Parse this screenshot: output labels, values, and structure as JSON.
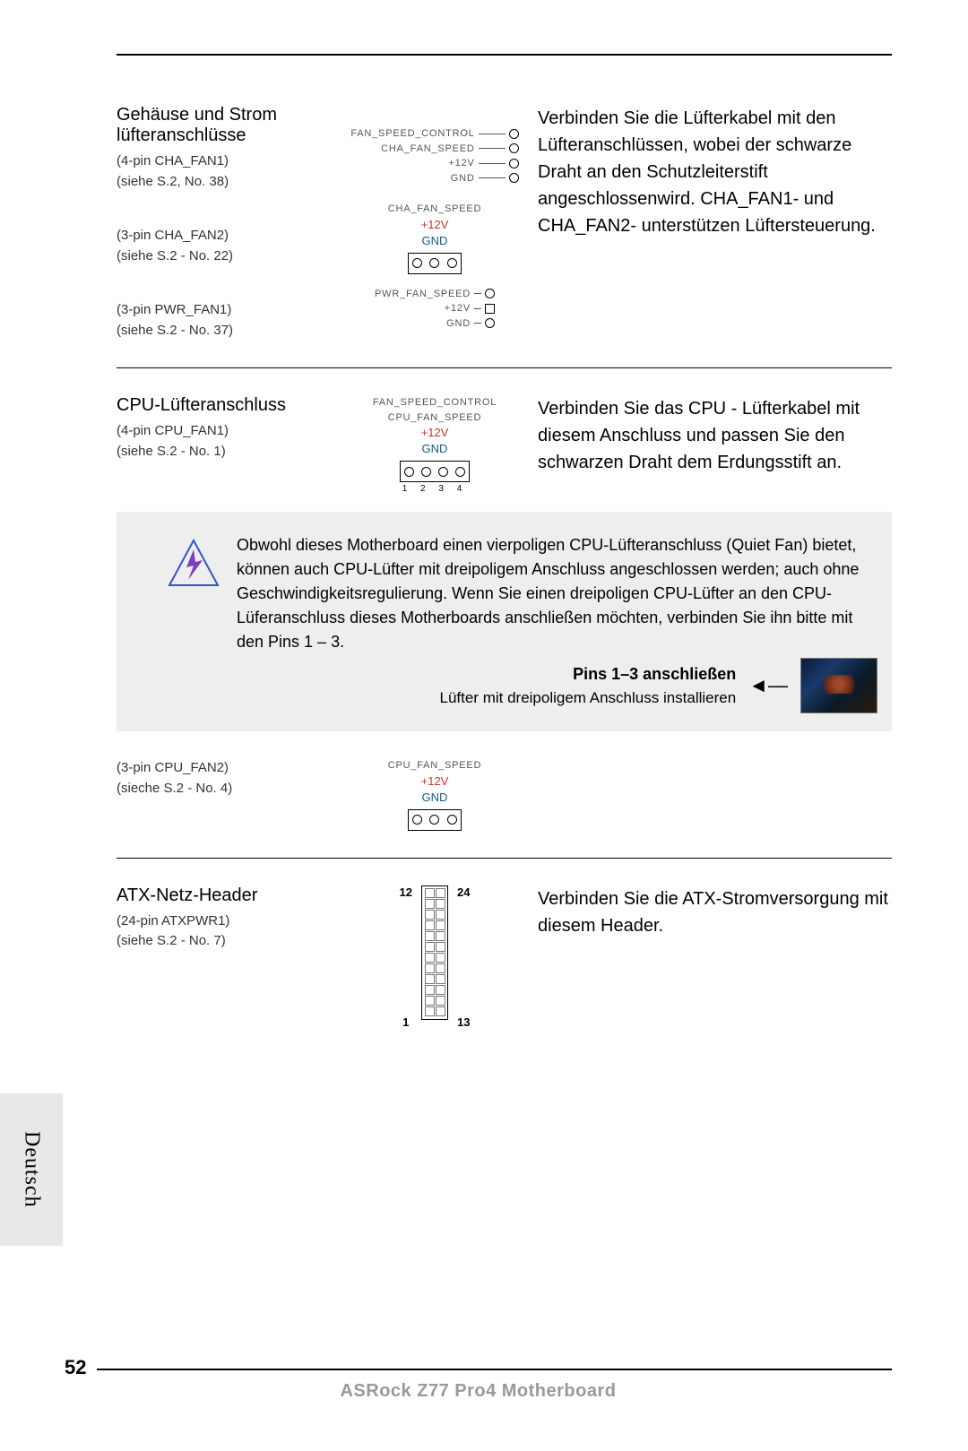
{
  "section1": {
    "title": "Gehäuse und Strom lüfteranschlüsse",
    "items": [
      {
        "label": "(4-pin CHA_FAN1)",
        "ref": "(siehe S.2, No. 38)"
      },
      {
        "label": "(3-pin CHA_FAN2)",
        "ref": "(siehe S.2 - No. 22)"
      },
      {
        "label": "(3-pin PWR_FAN1)",
        "ref": "(siehe S.2 - No. 37)"
      }
    ],
    "diag1": {
      "l1": "FAN_SPEED_CONTROL",
      "l2": "CHA_FAN_SPEED",
      "l3": "+12V",
      "l4": "GND"
    },
    "diag2": {
      "l1": "CHA_FAN_SPEED",
      "l2": "+12V",
      "l3": "GND"
    },
    "diag3": {
      "l1": "PWR_FAN_SPEED",
      "l2": "+12V",
      "l3": "GND"
    },
    "desc": "Verbinden Sie die Lüfterkabel mit den Lüfteranschlüssen, wobei der schwarze Draht an den Schutzleiterstift angeschlossenwird. CHA_FAN1- und CHA_FAN2- unterstützen Lüftersteuerung."
  },
  "section2": {
    "title": "CPU-Lüfteranschluss",
    "items": [
      {
        "label": "(4-pin  CPU_FAN1)",
        "ref": "(siehe S.2 - No. 1)"
      }
    ],
    "diag": {
      "l1": "FAN_SPEED_CONTROL",
      "l2": "CPU_FAN_SPEED",
      "l3": "+12V",
      "l4": "GND",
      "nums": "1   2   3   4"
    },
    "desc": "Verbinden Sie das CPU - Lüfterkabel mit diesem Anschluss und passen Sie den schwarzen Draht dem Erdungsstift an."
  },
  "note": {
    "text": "Obwohl dieses Motherboard einen vierpoligen CPU-Lüfteranschluss (Quiet Fan) bietet, können auch CPU-Lüfter mit dreipoligem Anschluss angeschlossen werden; auch ohne Geschwindigkeitsregulierung. Wenn Sie einen dreipoligen CPU-Lüfter an den CPU-Lüferanschluss dieses Motherboards anschließen möchten, verbinden Sie ihn bitte mit den Pins 1 – 3.",
    "bold": "Pins 1–3 anschließen",
    "sub": "Lüfter mit dreipoligem Anschluss installieren"
  },
  "section3": {
    "items": [
      {
        "label": "(3-pin CPU_FAN2)",
        "ref": "(sieche S.2 - No. 4)"
      }
    ],
    "diag": {
      "l1": "CPU_FAN_SPEED",
      "l2": "+12V",
      "l3": "GND"
    }
  },
  "section4": {
    "title": "ATX-Netz-Header",
    "items": [
      {
        "label": "(24-pin  ATXPWR1)",
        "ref": "(siehe S.2 - No. 7)"
      }
    ],
    "pins": {
      "tl": "12",
      "tr": "24",
      "bl": "1",
      "br": "13"
    },
    "desc": "Verbinden Sie die ATX-Stromversorgung mit diesem Header."
  },
  "lang": "Deutsch",
  "page_num": "52",
  "footer": "ASRock  Z77  Pro4  Motherboard"
}
